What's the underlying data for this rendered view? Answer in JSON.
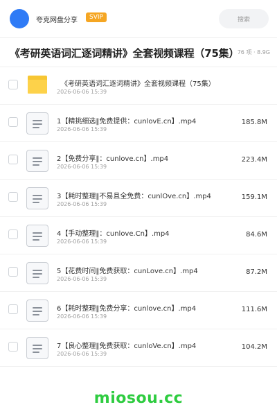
{
  "header": {
    "brand": "夸克网盘分享",
    "badge": "SVIP",
    "search_placeholder": "搜索",
    "colors": {
      "avatar": "#2f7bf6",
      "badge": "#f5a623"
    }
  },
  "share": {
    "title": "《考研英语词汇逐词精讲》全套视频课程（75集）",
    "meta": "76 项 · 8.9G"
  },
  "folder": {
    "name": "《考研英语词汇逐词精讲》全套视频课程（75集）",
    "date": "2026-06-06 15:39",
    "icon": "folder-icon"
  },
  "files": [
    {
      "name": "1【精挑细选‖免费提供：cunlovE.cn】.mp4",
      "date": "2026-06-06 15:39",
      "size": "185.8M"
    },
    {
      "name": "2【免费分享‖：cunlove.cn】.mp4",
      "date": "2026-06-06 15:39",
      "size": "223.4M"
    },
    {
      "name": "3【耗时整理‖不易且全免费：cunlOve.cn】.mp4",
      "date": "2026-06-06 15:39",
      "size": "159.1M"
    },
    {
      "name": "4【手动整理‖：cunlove.Cn】.mp4",
      "date": "2026-06-06 15:39",
      "size": "84.6M"
    },
    {
      "name": "5【花费时间‖免费获取：cunLove.cn】.mp4",
      "date": "2026-06-06 15:39",
      "size": "87.2M"
    },
    {
      "name": "6【耗时整理‖免费分享：cunlove.cn】.mp4",
      "date": "2026-06-06 15:39",
      "size": "111.6M"
    },
    {
      "name": "7【良心整理‖免费获取：cunloVe.cn】.mp4",
      "date": "2026-06-06 15:39",
      "size": "104.2M"
    }
  ],
  "watermark": "miosou.cc"
}
